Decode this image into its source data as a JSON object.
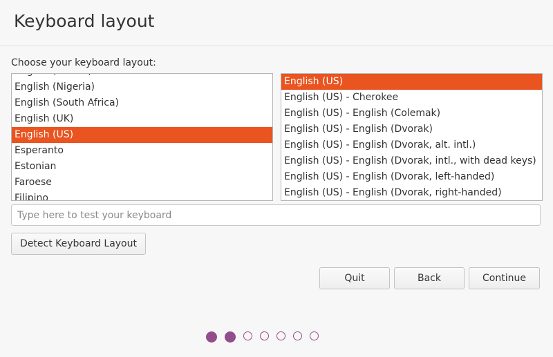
{
  "header": {
    "title": "Keyboard layout"
  },
  "prompt": "Choose your keyboard layout:",
  "layouts": {
    "items": [
      {
        "label": "English (Ghana)",
        "selected": false
      },
      {
        "label": "English (Nigeria)",
        "selected": false
      },
      {
        "label": "English (South Africa)",
        "selected": false
      },
      {
        "label": "English (UK)",
        "selected": false
      },
      {
        "label": "English (US)",
        "selected": true
      },
      {
        "label": "Esperanto",
        "selected": false
      },
      {
        "label": "Estonian",
        "selected": false
      },
      {
        "label": "Faroese",
        "selected": false
      },
      {
        "label": "Filipino",
        "selected": false
      }
    ]
  },
  "variants": {
    "items": [
      {
        "label": "English (US)",
        "selected": true
      },
      {
        "label": "English (US) - Cherokee",
        "selected": false
      },
      {
        "label": "English (US) - English (Colemak)",
        "selected": false
      },
      {
        "label": "English (US) - English (Dvorak)",
        "selected": false
      },
      {
        "label": "English (US) - English (Dvorak, alt. intl.)",
        "selected": false
      },
      {
        "label": "English (US) - English (Dvorak, intl., with dead keys)",
        "selected": false
      },
      {
        "label": "English (US) - English (Dvorak, left-handed)",
        "selected": false
      },
      {
        "label": "English (US) - English (Dvorak, right-handed)",
        "selected": false
      }
    ]
  },
  "test_field": {
    "placeholder": "Type here to test your keyboard",
    "value": ""
  },
  "buttons": {
    "detect": "Detect Keyboard Layout",
    "quit": "Quit",
    "back": "Back",
    "continue": "Continue"
  },
  "progress": {
    "total_steps": 7,
    "completed_steps": 2
  },
  "colors": {
    "accent": "#e95420",
    "step_dot": "#924d8b"
  }
}
